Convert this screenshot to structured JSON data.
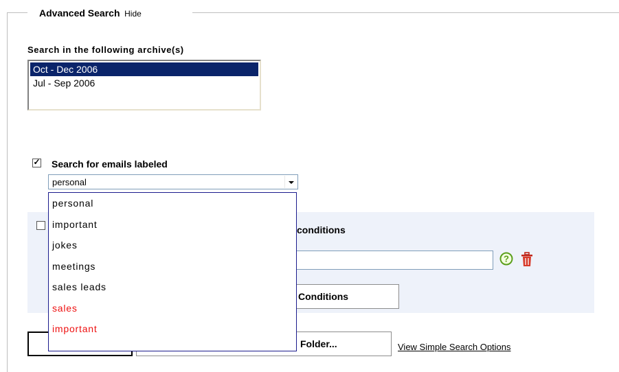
{
  "advanced_search": {
    "title": "Advanced Search",
    "hide_label": "Hide"
  },
  "archive": {
    "label": "Search in the following archive(s)",
    "items": [
      "Oct - Dec 2006",
      "Jul - Sep 2006"
    ],
    "selected": "Oct - Dec 2006"
  },
  "labeled": {
    "checkbox_checked": true,
    "label": "Search for emails labeled",
    "selected_value": "personal",
    "options": [
      {
        "label": "personal",
        "color": "#000000"
      },
      {
        "label": "important",
        "color": "#000000"
      },
      {
        "label": "jokes",
        "color": "#000000"
      },
      {
        "label": "meetings",
        "color": "#000000"
      },
      {
        "label": "sales leads",
        "color": "#000000"
      },
      {
        "label": "sales",
        "color": "#ee1111"
      },
      {
        "label": "important",
        "color": "#ee1111"
      }
    ]
  },
  "conditions": {
    "checkbox_checked": false,
    "label_visible_part": "conditions",
    "input_value": "",
    "clear_button_visible_part": "Conditions"
  },
  "actions": {
    "folder_button_visible_part": "Folder...",
    "simple_search_link": "View Simple Search Options"
  },
  "colors": {
    "selection": "#0a246a",
    "panel": "#eef2fa",
    "label_red": "#ee1111"
  }
}
